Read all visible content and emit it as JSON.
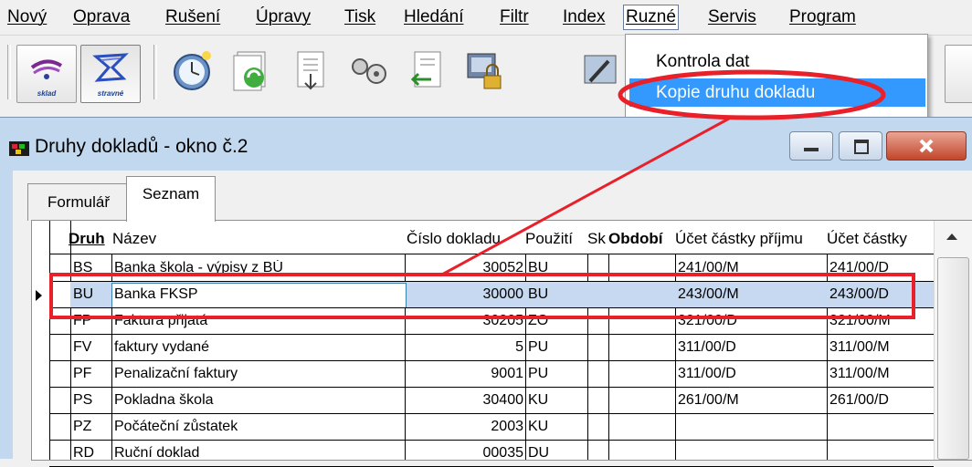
{
  "menubar": {
    "items": [
      "Nový",
      "Oprava",
      "Rušení",
      "Úpravy",
      "Tisk",
      "Hledání",
      "Filtr",
      "Index",
      "Ruzné",
      "Servis",
      "Program"
    ],
    "active_index": 8
  },
  "toolbar": {
    "buttons": [
      {
        "label": "sklad",
        "icon": "warehouse-icon"
      },
      {
        "label": "stravné",
        "icon": "meal-allowance-icon"
      }
    ],
    "icons": [
      "clock-icon",
      "recycle-icon",
      "document-import-icon",
      "wrench-icon",
      "document-export-icon",
      "lock-icon",
      "tools-icon"
    ]
  },
  "dropdown": {
    "items": [
      "Kontrola dat",
      "Kopie druhu dokladu"
    ],
    "selected_index": 1
  },
  "window": {
    "title": "Druhy dokladů - okno č.2",
    "tabs": [
      "Formulář",
      "Seznam"
    ],
    "active_tab": 1
  },
  "grid": {
    "headers": [
      "Druh",
      "Název",
      "Číslo dokladu",
      "Použití",
      "Sk",
      "Období",
      "Účet částky příjmu",
      "Účet částky"
    ],
    "rows": [
      [
        "BS",
        "Banka škola - výpisy z BÚ",
        "30052",
        "BU",
        "",
        "",
        "241/00/M",
        "241/00/D"
      ],
      [
        "BU",
        "Banka FKSP",
        "30000",
        "BU",
        "",
        "",
        "243/00/M",
        "243/00/D"
      ],
      [
        "FP",
        "Faktura přijatá",
        "30205",
        "ZO",
        "",
        "",
        "321/00/D",
        "321/00/M"
      ],
      [
        "FV",
        "faktury vydané",
        "5",
        "PU",
        "",
        "",
        "311/00/D",
        "311/00/M"
      ],
      [
        "PF",
        "Penalizační faktury",
        "9001",
        "PU",
        "",
        "",
        "311/00/D",
        "311/00/M"
      ],
      [
        "PS",
        "Pokladna škola",
        "30400",
        "KU",
        "",
        "",
        "261/00/M",
        "261/00/D"
      ],
      [
        "PZ",
        "Počáteční zůstatek",
        "2003",
        "KU",
        "",
        "",
        "",
        ""
      ],
      [
        "RD",
        "Ruční doklad",
        "00035",
        "DU",
        "",
        "",
        "",
        ""
      ]
    ],
    "selected_row": 1
  },
  "colors": {
    "menu_highlight": "#3399ff",
    "row_highlight": "#c6d9f0",
    "annotation_red": "#e8202a",
    "window_frame": "#c2d8ef"
  }
}
